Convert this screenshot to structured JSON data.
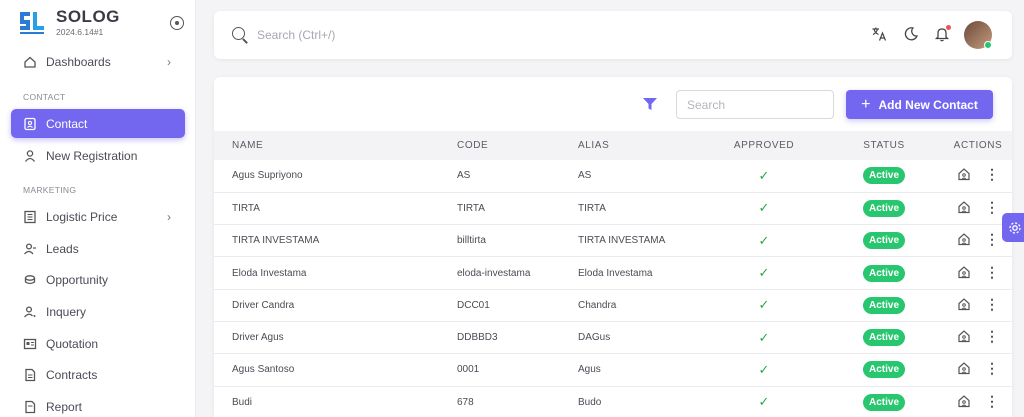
{
  "brand": {
    "name": "SOLOG",
    "version": "2024.6.14#1"
  },
  "sidebar": {
    "items_top": [
      {
        "label": "Dashboards",
        "icon": "home-icon",
        "has_chevron": true
      }
    ],
    "sections": [
      {
        "title": "CONTACT"
      },
      {
        "title": "MARKETING"
      }
    ],
    "contact_items": [
      {
        "label": "Contact",
        "icon": "contact-card-icon",
        "active": true
      },
      {
        "label": "New Registration",
        "icon": "user-icon"
      }
    ],
    "marketing_items": [
      {
        "label": "Logistic Price",
        "icon": "list-icon",
        "has_chevron": true
      },
      {
        "label": "Leads",
        "icon": "user-add-icon"
      },
      {
        "label": "Opportunity",
        "icon": "coin-icon"
      },
      {
        "label": "Inquery",
        "icon": "user-question-icon"
      },
      {
        "label": "Quotation",
        "icon": "quotation-icon"
      },
      {
        "label": "Contracts",
        "icon": "document-icon"
      },
      {
        "label": "Report",
        "icon": "report-icon"
      }
    ]
  },
  "topbar": {
    "search_placeholder": "Search (Ctrl+/)"
  },
  "toolbar": {
    "search_placeholder": "Search",
    "add_label": "Add New Contact"
  },
  "table": {
    "columns": [
      "NAME",
      "CODE",
      "ALIAS",
      "APPROVED",
      "STATUS",
      "ACTIONS"
    ],
    "rows": [
      {
        "name": "Agus Supriyono",
        "code": "AS",
        "alias": "AS",
        "approved": "✓",
        "status": "Active"
      },
      {
        "name": "TIRTA",
        "code": "TIRTA",
        "alias": "TIRTA",
        "approved": "✓",
        "status": "Active"
      },
      {
        "name": "TIRTA INVESTAMA",
        "code": "billtirta",
        "alias": "TIRTA INVESTAMA",
        "approved": "✓",
        "status": "Active"
      },
      {
        "name": "Eloda Investama",
        "code": "eloda-investama",
        "alias": "Eloda Investama",
        "approved": "✓",
        "status": "Active"
      },
      {
        "name": "Driver Candra",
        "code": "DCC01",
        "alias": "Chandra",
        "approved": "✓",
        "status": "Active"
      },
      {
        "name": "Driver Agus",
        "code": "DDBBD3",
        "alias": "DAGus",
        "approved": "✓",
        "status": "Active"
      },
      {
        "name": "Agus Santoso",
        "code": "0001",
        "alias": "Agus",
        "approved": "✓",
        "status": "Active"
      },
      {
        "name": "Budi",
        "code": "678",
        "alias": "Budo",
        "approved": "✓",
        "status": "Active"
      }
    ]
  },
  "colors": {
    "primary": "#7367f0",
    "success": "#28c76f",
    "danger": "#ea5455"
  }
}
